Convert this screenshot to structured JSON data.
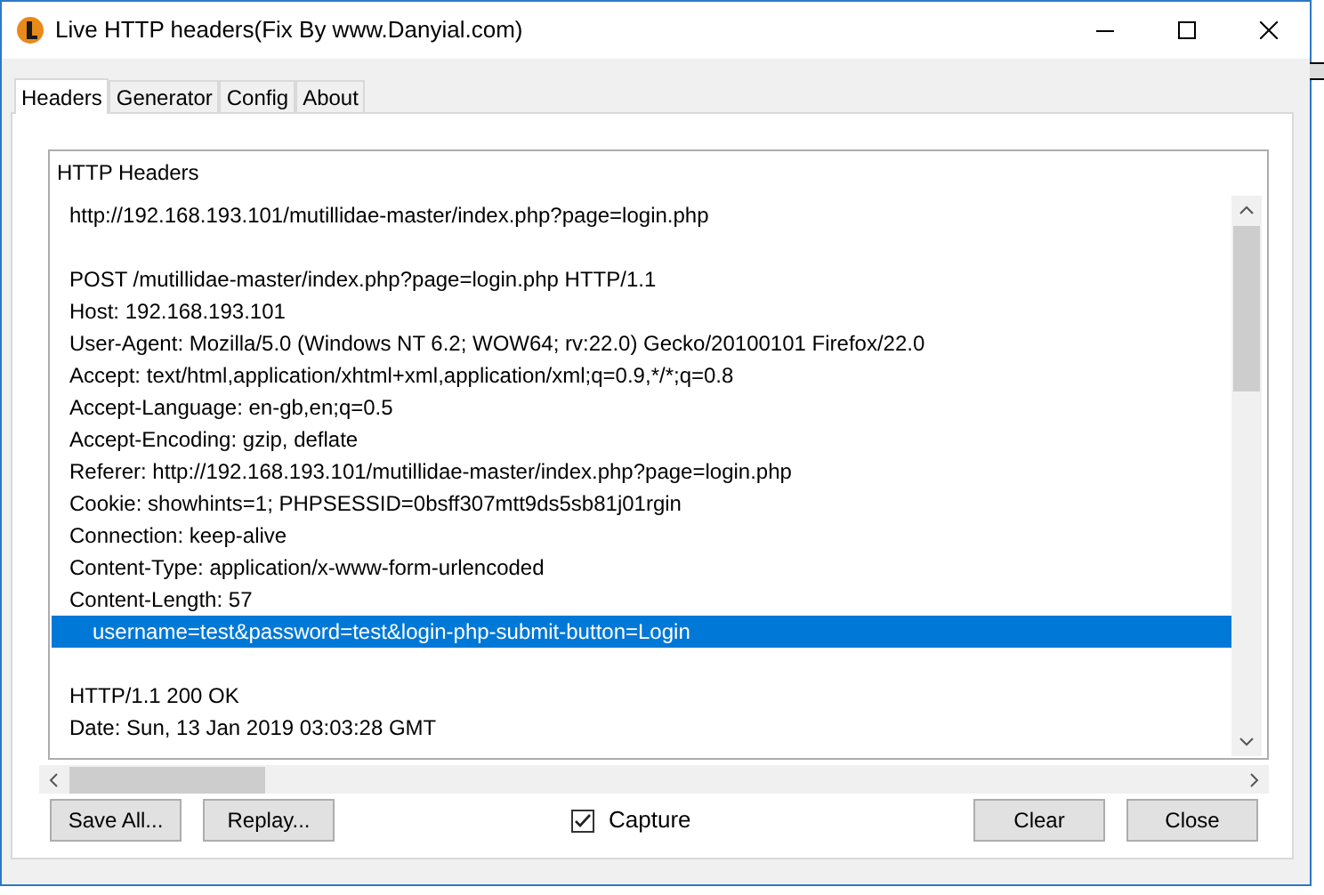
{
  "window": {
    "title": "Live HTTP headers(Fix By www.Danyial.com)"
  },
  "tabs": [
    {
      "label": "Headers",
      "selected": true
    },
    {
      "label": "Generator",
      "selected": false
    },
    {
      "label": "Config",
      "selected": false
    },
    {
      "label": "About",
      "selected": false
    }
  ],
  "group": {
    "title": "HTTP Headers"
  },
  "lines": [
    {
      "kind": "text",
      "text": "http://192.168.193.101/mutillidae-master/index.php?page=login.php",
      "selected": false,
      "indented": false
    },
    {
      "kind": "blank"
    },
    {
      "kind": "text",
      "text": "POST /mutillidae-master/index.php?page=login.php HTTP/1.1",
      "selected": false,
      "indented": false
    },
    {
      "kind": "text",
      "text": "Host: 192.168.193.101",
      "selected": false,
      "indented": false
    },
    {
      "kind": "text",
      "text": "User-Agent: Mozilla/5.0 (Windows NT 6.2; WOW64; rv:22.0) Gecko/20100101 Firefox/22.0",
      "selected": false,
      "indented": false
    },
    {
      "kind": "text",
      "text": "Accept: text/html,application/xhtml+xml,application/xml;q=0.9,*/*;q=0.8",
      "selected": false,
      "indented": false
    },
    {
      "kind": "text",
      "text": "Accept-Language: en-gb,en;q=0.5",
      "selected": false,
      "indented": false
    },
    {
      "kind": "text",
      "text": "Accept-Encoding: gzip, deflate",
      "selected": false,
      "indented": false
    },
    {
      "kind": "text",
      "text": "Referer: http://192.168.193.101/mutillidae-master/index.php?page=login.php",
      "selected": false,
      "indented": false
    },
    {
      "kind": "text",
      "text": "Cookie: showhints=1; PHPSESSID=0bsff307mtt9ds5sb81j01rgin",
      "selected": false,
      "indented": false
    },
    {
      "kind": "text",
      "text": "Connection: keep-alive",
      "selected": false,
      "indented": false
    },
    {
      "kind": "text",
      "text": "Content-Type: application/x-www-form-urlencoded",
      "selected": false,
      "indented": false
    },
    {
      "kind": "text",
      "text": "Content-Length: 57",
      "selected": false,
      "indented": false
    },
    {
      "kind": "text",
      "text": "username=test&password=test&login-php-submit-button=Login",
      "selected": true,
      "indented": true
    },
    {
      "kind": "blank"
    },
    {
      "kind": "text",
      "text": "HTTP/1.1 200 OK",
      "selected": false,
      "indented": false
    },
    {
      "kind": "text",
      "text": "Date: Sun, 13 Jan 2019 03:03:28 GMT",
      "selected": false,
      "indented": false
    }
  ],
  "buttons_left": [
    "Save All...",
    "Replay..."
  ],
  "capture": {
    "label": "Capture",
    "checked": true
  },
  "buttons_right": [
    "Clear",
    "Close"
  ]
}
